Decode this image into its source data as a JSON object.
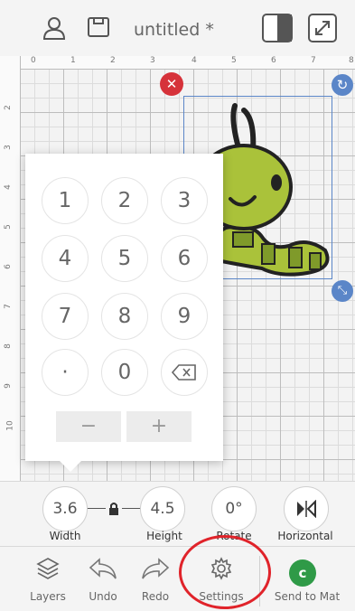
{
  "header": {
    "title": "untitled *",
    "icons": [
      "user-icon",
      "save-icon",
      "split-view-icon",
      "expand-icon"
    ]
  },
  "ruler": {
    "top": [
      "0",
      "1",
      "2",
      "3",
      "4",
      "5",
      "6",
      "7",
      "8"
    ],
    "left": [
      "2",
      "3",
      "4",
      "5",
      "6",
      "7",
      "8",
      "9",
      "10"
    ]
  },
  "keypad": {
    "keys": [
      "1",
      "2",
      "3",
      "4",
      "5",
      "6",
      "7",
      "8",
      "9",
      "·",
      "0"
    ],
    "minus": "−",
    "plus": "+",
    "backspace": "⌫"
  },
  "properties": {
    "width": {
      "value": "3.6",
      "label": "Width"
    },
    "height": {
      "value": "4.5",
      "label": "Height"
    },
    "rotate": {
      "value": "0°",
      "label": "Rotate"
    },
    "flip": {
      "value": "⧓",
      "label": "Horizontal"
    }
  },
  "toolbar": {
    "layers": "Layers",
    "undo": "Undo",
    "redo": "Redo",
    "settings": "Settings",
    "send": "Send to Mat"
  },
  "colors": {
    "accent_blue": "#5b86c8",
    "delete_red": "#d6323a",
    "send_green": "#2f9a47",
    "worm_green": "#aac23a"
  }
}
